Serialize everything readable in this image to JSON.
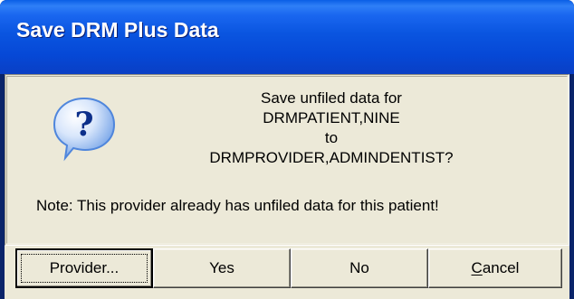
{
  "window": {
    "title": "Save DRM Plus Data"
  },
  "dialog": {
    "icon": "question-icon",
    "message_lines": [
      "Save unfiled data for",
      "DRMPATIENT,NINE",
      "to",
      "DRMPROVIDER,ADMINDENTIST?"
    ],
    "note": "Note: This provider already has unfiled data for this patient!"
  },
  "buttons": {
    "provider": "Provider...",
    "yes": "Yes",
    "no": "No",
    "cancel": "Cancel"
  },
  "colors": {
    "titlebar": "#0a55e0",
    "face": "#ece9d8",
    "icon_bubble": "#4f86dc"
  }
}
